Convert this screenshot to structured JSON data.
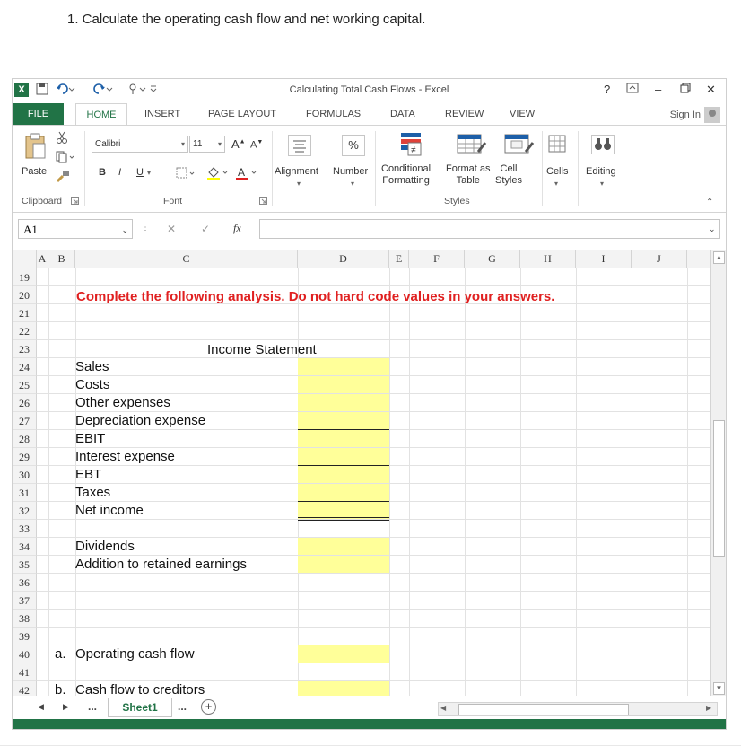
{
  "question": "1. Calculate the operating cash flow and net working capital.",
  "window": {
    "title": "Calculating Total Cash Flows - Excel",
    "help": "?",
    "sign_in": "Sign In"
  },
  "tabs": [
    "FILE",
    "HOME",
    "INSERT",
    "PAGE LAYOUT",
    "FORMULAS",
    "DATA",
    "REVIEW",
    "VIEW"
  ],
  "ribbon": {
    "paste": "Paste",
    "font_name": "Calibri",
    "font_size": "11",
    "bold": "B",
    "italic": "I",
    "underline": "U",
    "alignment": "Alignment",
    "number": "Number",
    "percent": "%",
    "conditional_formatting": [
      "Conditional",
      "Formatting"
    ],
    "format_as_table": [
      "Format as",
      "Table"
    ],
    "cell_styles": [
      "Cell",
      "Styles"
    ],
    "cells": "Cells",
    "editing": "Editing",
    "groups": {
      "clipboard": "Clipboard",
      "font": "Font",
      "styles": "Styles"
    }
  },
  "formula_bar": {
    "name_box": "A1",
    "fx": "fx",
    "value": ""
  },
  "columns": [
    "A",
    "B",
    "C",
    "D",
    "E",
    "F",
    "G",
    "H",
    "I",
    "J"
  ],
  "rows": [
    "19",
    "20",
    "21",
    "22",
    "23",
    "24",
    "25",
    "26",
    "27",
    "28",
    "29",
    "30",
    "31",
    "32",
    "33",
    "34",
    "35",
    "36",
    "37",
    "38",
    "39",
    "40",
    "41",
    "42"
  ],
  "sheet": {
    "instruction": "Complete the following analysis. Do not hard code values in your answers.",
    "income_statement_title": "Income Statement",
    "items": [
      "Sales",
      "Costs",
      "Other expenses",
      "Depreciation expense",
      "EBIT",
      "Interest expense",
      "EBT",
      "Taxes",
      "Net income"
    ],
    "dividends": "Dividends",
    "addition_to_re": "Addition to retained earnings",
    "a_label": "a.",
    "a_text": "Operating cash flow",
    "b_label": "b.",
    "b_text": "Cash flow to creditors"
  },
  "sheet_tabs": {
    "more_left": "...",
    "active": "Sheet1",
    "more_right": "...",
    "add": "+"
  },
  "colors": {
    "excel_green": "#217346",
    "input_yellow": "#ffff99",
    "warning_red": "#e02020"
  }
}
